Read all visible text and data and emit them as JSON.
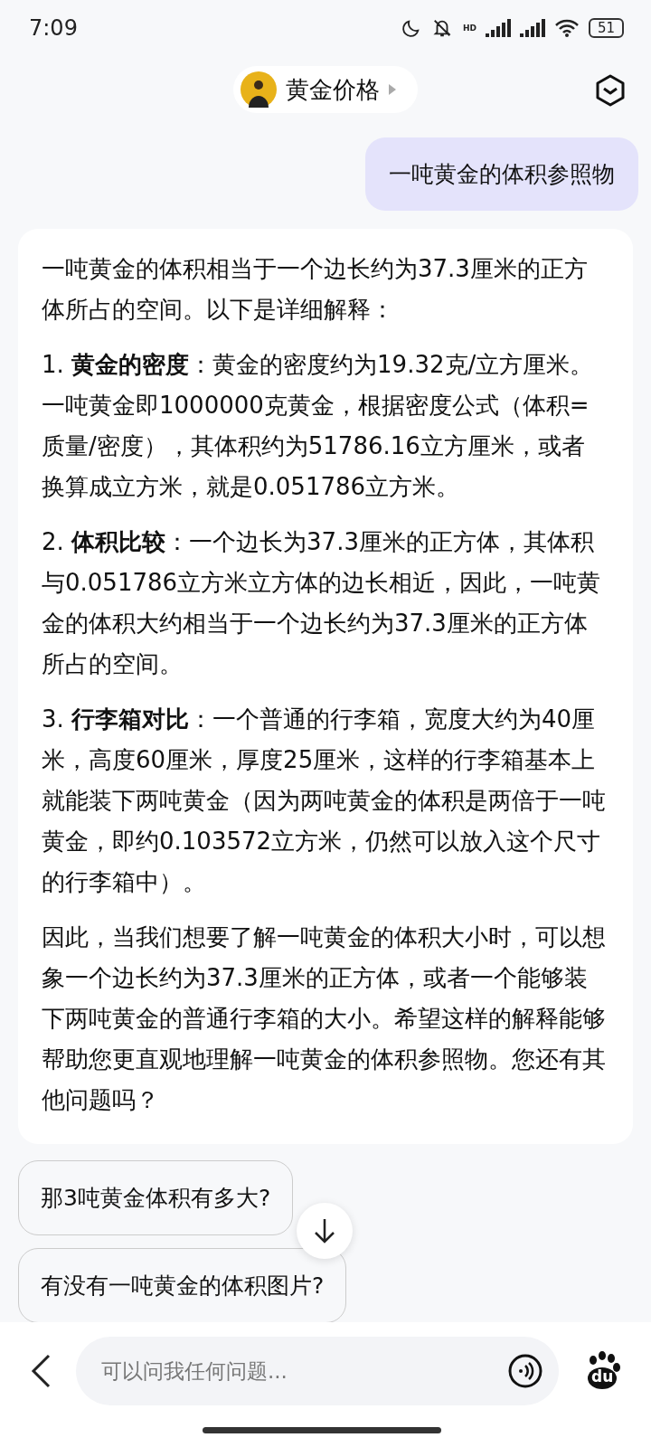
{
  "status_bar": {
    "time": "7:09",
    "network_label": "HD",
    "battery": "51"
  },
  "header": {
    "title": "黄金价格"
  },
  "user_message": "一吨黄金的体积参照物",
  "answer": {
    "paragraphs": [
      "一吨黄金的体积相当于一个边长约为37.3厘米的正方体所占的空间。以下是详细解释：",
      "1. **黄金的密度**：黄金的密度约为19.32克/立方厘米。一吨黄金即1000000克黄金，根据密度公式（体积=质量/密度），其体积约为51786.16立方厘米，或者换算成立方米，就是0.051786立方米。",
      "2. **体积比较**：一个边长为37.3厘米的正方体，其体积与0.051786立方米立方体的边长相近，因此，一吨黄金的体积大约相当于一个边长约为37.3厘米的正方体所占的空间。",
      "3. **行李箱对比**：一个普通的行李箱，宽度大约为40厘米，高度60厘米，厚度25厘米，这样的行李箱基本上就能装下两吨黄金（因为两吨黄金的体积是两倍于一吨黄金，即约0.103572立方米，仍然可以放入这个尺寸的行李箱中）。",
      "因此，当我们想要了解一吨黄金的体积大小时，可以想象一个边长约为37.3厘米的正方体，或者一个能够装下两吨黄金的普通行李箱的大小。希望这样的解释能够帮助您更直观地理解一吨黄金的体积参照物。您还有其他问题吗？"
    ]
  },
  "suggestions": [
    "那3吨黄金体积有多大?",
    "有没有一吨黄金的体积图片?"
  ],
  "input": {
    "placeholder": "可以问我任何问题..."
  },
  "logo_text": "du"
}
